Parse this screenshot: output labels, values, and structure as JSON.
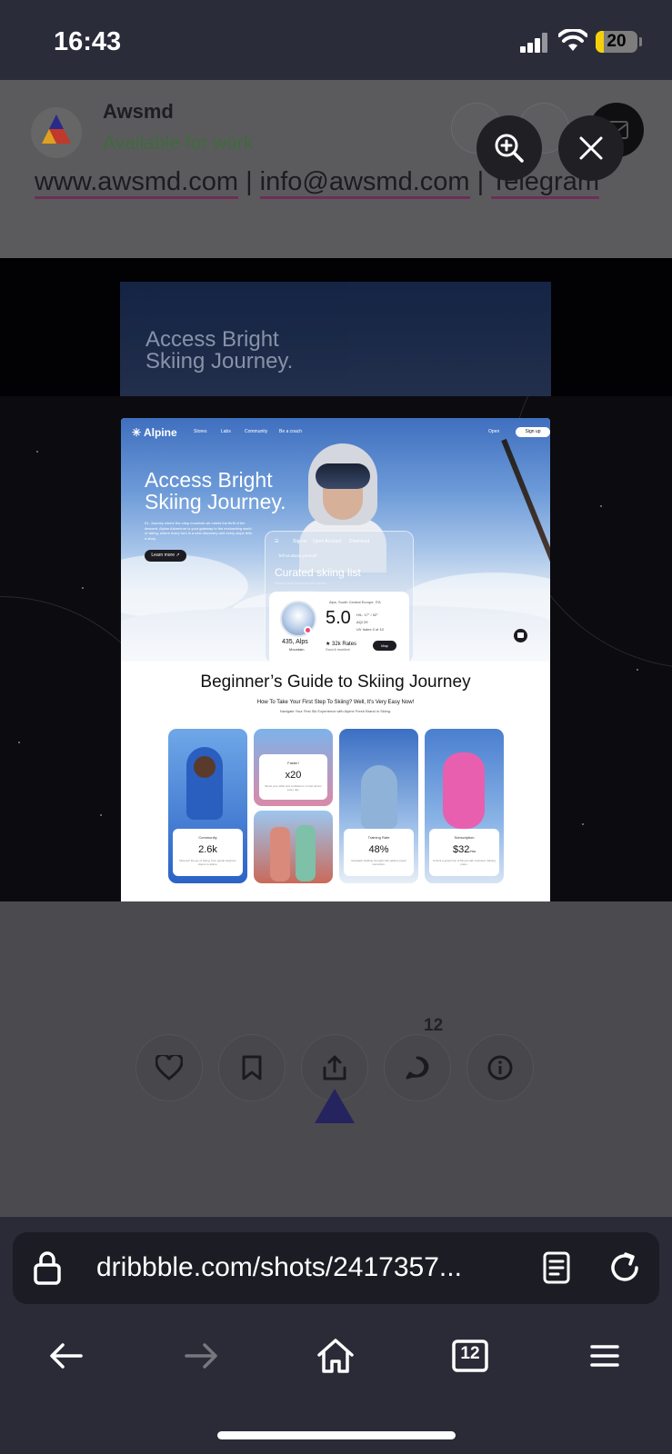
{
  "status_bar": {
    "time": "16:43",
    "battery": "20",
    "battery_level": 0.2
  },
  "profile": {
    "name": "Awsmd",
    "availability": "Available for work",
    "links": [
      "www.awsmd.com",
      "info@awsmd.com",
      "Telegram"
    ]
  },
  "shot": {
    "nav": {
      "logo": "Alpine",
      "links": [
        "Stores",
        "Labs",
        "Community",
        "Be a coach"
      ],
      "open_label": "Open",
      "signup_label": "Sign up"
    },
    "hero": {
      "title": "Access Bright Skiing Journey.",
      "description": "01. Journey where the crisp mountain air meets the thrill of the descent. Alpine Adventure is your gateway to the enchanting world of skiing, where every turn is a new discovery and every slope tells a story.",
      "cta": "Learn more"
    },
    "card": {
      "tabs": [
        "Sign in",
        "Open Account",
        "Download"
      ],
      "subtitle": "Tell us about yourself",
      "title": "Curated skiing list",
      "caption": "Select most luxurious ski resorts",
      "location": "Alps, South Central Europe, ITA",
      "altitude": "435, Alps",
      "altitude_sub": "Mountain",
      "score": "5.0",
      "stats": [
        "H/L: 17° / 02°",
        "AQI 29",
        "UV Index 0 of 10"
      ],
      "rates": "32k Rates",
      "rates_sub": "Good & excellent",
      "map_label": "Map"
    },
    "guide": {
      "title": "Beginner’s Guide to Skiing Journey",
      "subtitle": "How To Take Your First Step To Skiing? Well, It's Very Easy Now!",
      "caption": "Navigate Your First Ski Experience with Alpine Fresh Brand in Skiing."
    },
    "tiles": [
      {
        "label": "Community",
        "value": "2.6k",
        "desc": "Discover the joy of skiing, from gentle beginner slopes to alpine."
      },
      {
        "label": "Faster!",
        "value": "x20",
        "desc": "Boost your skills and confidence on fast terrain every day."
      },
      {
        "label": "Training Rate",
        "value": "48%",
        "desc": "Gradually building strength with patient expert instruction."
      },
      {
        "label": "Subscription",
        "value": "$32",
        "unit": "/mo",
        "desc": "Unlock a great time of fitness with exclusive training plans."
      }
    ]
  },
  "viewer": {
    "zoom_icon": "zoom-in-icon",
    "close_icon": "close-icon"
  },
  "actions": {
    "comment_count": "12"
  },
  "browser": {
    "url": "dribbble.com/shots/2417357...",
    "tab_count": "12"
  }
}
